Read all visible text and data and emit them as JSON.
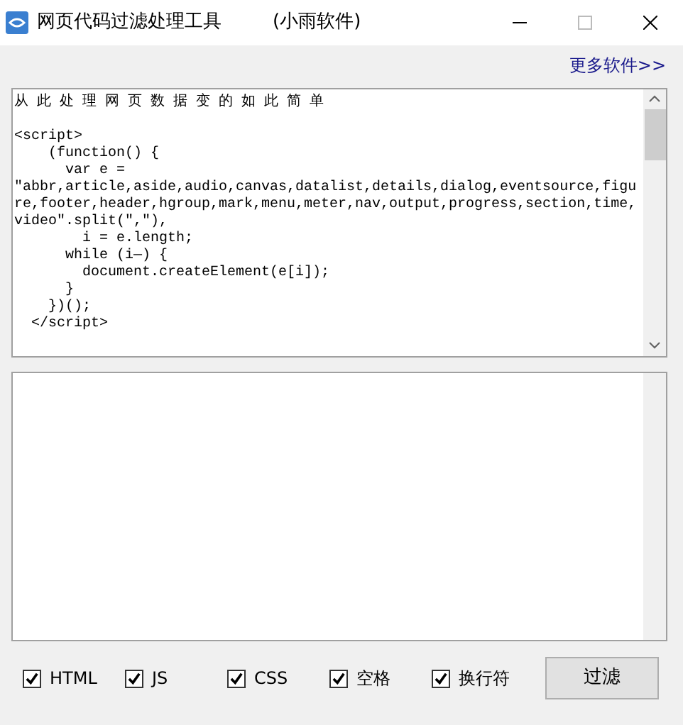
{
  "window": {
    "title": "网页代码过滤处理工具",
    "subtitle": "(小雨软件)"
  },
  "more_link": "更多软件>>",
  "input_box": {
    "value": "从 此 处 理 网 页 数 据 变 的 如 此 简 单\n\n<script>\n    (function() {\n      var e =\n\"abbr,article,aside,audio,canvas,datalist,details,dialog,eventsource,figure,footer,header,hgroup,mark,menu,meter,nav,output,progress,section,time,video\".split(\",\"),\n        i = e.length;\n      while (i—) {\n        document.createElement(e[i]);\n      }\n    })();\n  </script>"
  },
  "options": [
    {
      "label": "HTML",
      "checked": true
    },
    {
      "label": "JS",
      "checked": true
    },
    {
      "label": "CSS",
      "checked": true
    },
    {
      "label": "空格",
      "checked": true
    },
    {
      "label": "换行符",
      "checked": true
    }
  ],
  "filter_button": "过滤"
}
